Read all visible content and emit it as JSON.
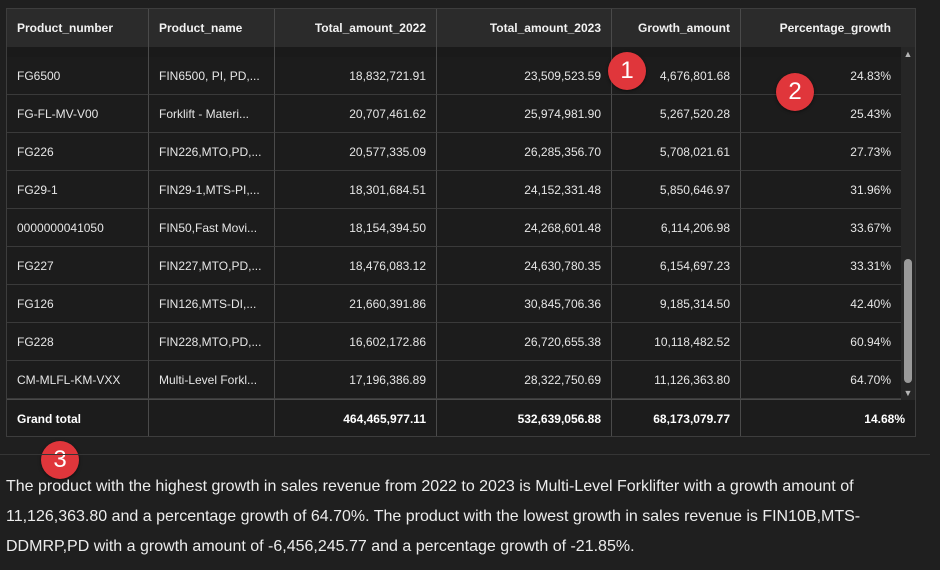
{
  "table": {
    "columns": [
      "Product_number",
      "Product_name",
      "Total_amount_2022",
      "Total_amount_2023",
      "Growth_amount",
      "Percentage_growth"
    ],
    "rows": [
      [
        "FG6500",
        "FIN6500, PI, PD,...",
        "18,832,721.91",
        "23,509,523.59",
        "4,676,801.68",
        "24.83%"
      ],
      [
        "FG-FL-MV-V00",
        "Forklift - Materi...",
        "20,707,461.62",
        "25,974,981.90",
        "5,267,520.28",
        "25.43%"
      ],
      [
        "FG226",
        "FIN226,MTO,PD,...",
        "20,577,335.09",
        "26,285,356.70",
        "5,708,021.61",
        "27.73%"
      ],
      [
        "FG29-1",
        "FIN29-1,MTS-PI,...",
        "18,301,684.51",
        "24,152,331.48",
        "5,850,646.97",
        "31.96%"
      ],
      [
        "0000000041050",
        "FIN50,Fast Movi...",
        "18,154,394.50",
        "24,268,601.48",
        "6,114,206.98",
        "33.67%"
      ],
      [
        "FG227",
        "FIN227,MTO,PD,...",
        "18,476,083.12",
        "24,630,780.35",
        "6,154,697.23",
        "33.31%"
      ],
      [
        "FG126",
        "FIN126,MTS-DI,...",
        "21,660,391.86",
        "30,845,706.36",
        "9,185,314.50",
        "42.40%"
      ],
      [
        "FG228",
        "FIN228,MTO,PD,...",
        "16,602,172.86",
        "26,720,655.38",
        "10,118,482.52",
        "60.94%"
      ],
      [
        "CM-MLFL-KM-VXX",
        "Multi-Level Forkl...",
        "17,196,386.89",
        "28,322,750.69",
        "11,126,363.80",
        "64.70%"
      ]
    ],
    "total": [
      "Grand total",
      "",
      "464,465,977.11",
      "532,639,056.88",
      "68,173,079.77",
      "14.68%"
    ]
  },
  "badges": [
    "1",
    "2",
    "3"
  ],
  "summary": "The product with the highest growth in sales revenue from 2022 to 2023 is Multi-Level Forklifter with a growth amount of 11,126,363.80 and a percentage growth of 64.70%. The product with the lowest growth in sales revenue is FIN10B,MTS-DDMRP,PD with a growth amount of -6,456,245.77 and a percentage growth of -21.85%.",
  "scrollbar": {
    "up_glyph": "▲",
    "down_glyph": "▼"
  },
  "colors": {
    "badge": "#e0363b",
    "background": "#1f1f1f",
    "header": "#2b2b2b"
  }
}
